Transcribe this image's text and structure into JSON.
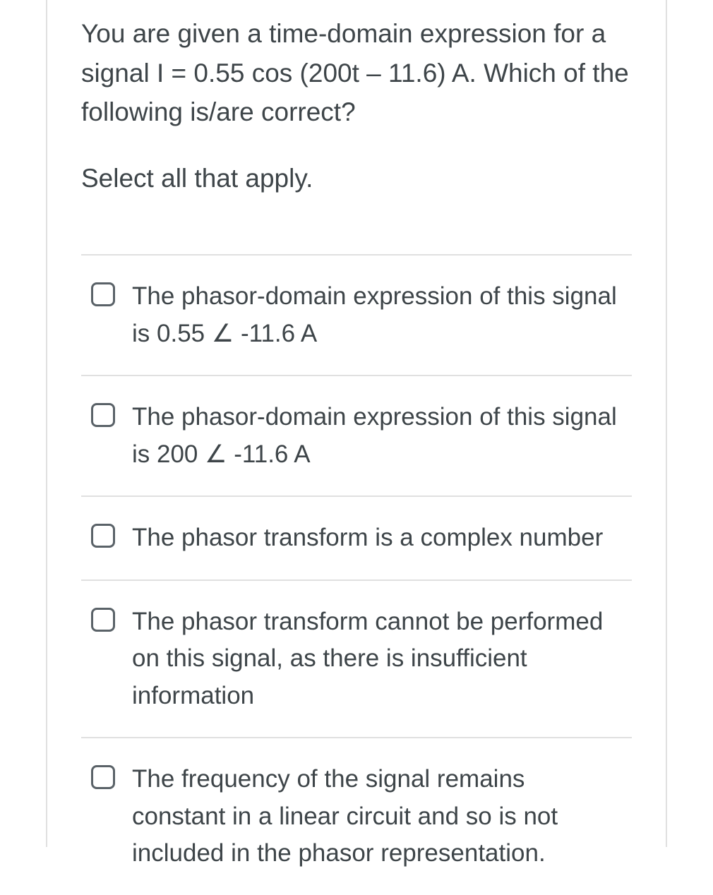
{
  "question": {
    "prompt": "You are given a time-domain expression for a signal I = 0.55 cos (200t – 11.6) A. Which of the following is/are correct?",
    "instruction": "Select all that apply."
  },
  "options": [
    {
      "label": "The phasor-domain expression of this signal is 0.55 ∠ -11.6 A"
    },
    {
      "label": "The phasor-domain expression of this signal is 200 ∠ -11.6 A"
    },
    {
      "label": "The phasor transform is a complex number"
    },
    {
      "label": "The phasor transform cannot be performed on this signal, as there is insufficient information"
    },
    {
      "label": "The frequency of the signal remains constant in a linear circuit and so is not included in the phasor representation."
    }
  ]
}
